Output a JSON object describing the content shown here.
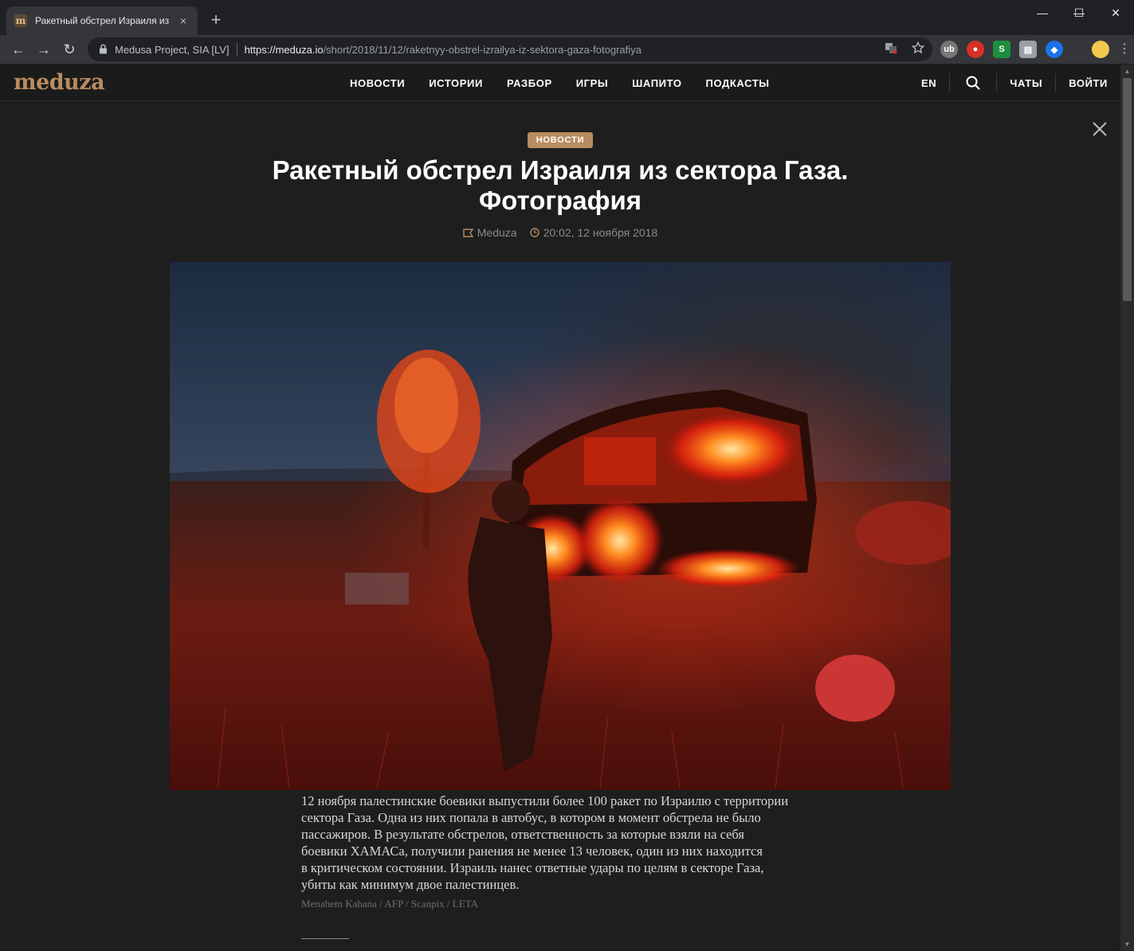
{
  "browser": {
    "tab": {
      "favicon": "m",
      "title": "Ракетный обстрел Израиля из с",
      "close": "×"
    },
    "new_tab": "+",
    "window": {
      "minimize": "—",
      "maximize": "☐",
      "close": "✕"
    },
    "nav": {
      "back": "←",
      "forward": "→",
      "reload": "↻"
    },
    "omnibox": {
      "site_identity": "Medusa Project, SIA [LV]",
      "url_host": "https://meduza.io",
      "url_path": "/short/2018/11/12/raketnyy-obstrel-izrailya-iz-sektora-gaza-fotografiya",
      "icons": [
        "translate-icon",
        "star-icon"
      ]
    },
    "extensions": [
      {
        "name": "ublock-extension-icon",
        "label": "ub"
      },
      {
        "name": "ghostery-extension-icon",
        "label": "●"
      },
      {
        "name": "s-extension-icon",
        "label": "S"
      },
      {
        "name": "folder-extension-icon",
        "label": "▤"
      },
      {
        "name": "shield-extension-icon",
        "label": "◆"
      }
    ],
    "menu": "⋮"
  },
  "site": {
    "logo": "meduza",
    "nav": [
      "НОВОСТИ",
      "ИСТОРИИ",
      "РАЗБОР",
      "ИГРЫ",
      "ШАПИТО",
      "ПОДКАСТЫ"
    ],
    "lang": "EN",
    "chats": "ЧАТЫ",
    "login": "ВОЙТИ",
    "colors": {
      "accent": "#b88c60",
      "background": "#1e1e1e",
      "header": "#1b1b1b"
    }
  },
  "article": {
    "tag": "НОВОСТИ",
    "title_line1": "Ракетный обстрел Израиля из сектора Газа.",
    "title_line2": "Фотография",
    "source": "Meduza",
    "datetime": "20:02, 12 ноября 2018",
    "caption_lines": [
      "12 ноября палестинские боевики выпустили более 100 ракет по Израилю с территории",
      "сектора Газа. Одна из них попала в автобус, в котором в момент обстрела не было",
      "пассажиров. В результате обстрелов, ответственность за которые взяли на себя",
      "боевики ХАМАСа, получили ранения не менее 13 человек, один из них находится",
      "в критическом состоянии. Израиль нанес ответные удары по целям в секторе Газа,",
      "убиты как минимум двое палестинцев."
    ],
    "credit": "Menahem Kahana / AFP / Scanpix / LETA"
  },
  "scrollbar": {
    "up": "▲",
    "down": "▼"
  }
}
